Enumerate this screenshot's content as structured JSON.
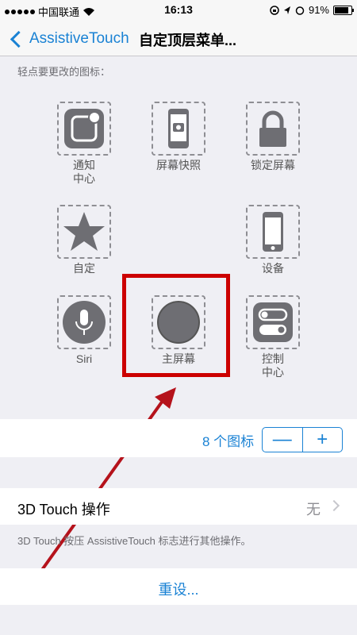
{
  "status_bar": {
    "carrier": "中国联通",
    "time": "16:13",
    "battery": "91%"
  },
  "nav": {
    "back_label": "AssistiveTouch",
    "title": "自定顶层菜单..."
  },
  "hint": "轻点要更改的图标：",
  "icons": [
    {
      "label": "通知\n中心",
      "icon": "notification-center-icon"
    },
    {
      "label": "屏幕快照",
      "icon": "screenshot-icon"
    },
    {
      "label": "锁定屏幕",
      "icon": "lock-icon"
    },
    {
      "label": "自定",
      "icon": "star-icon"
    },
    {
      "label": "设备",
      "icon": "device-icon"
    },
    {
      "label": "Siri",
      "icon": "siri-microphone-icon"
    },
    {
      "label": "主屏幕",
      "icon": "home-icon"
    },
    {
      "label": "控制\n中心",
      "icon": "control-center-icon"
    }
  ],
  "icon_count": {
    "label": "8 个图标",
    "minus": "—",
    "plus": "+"
  },
  "touch3d": {
    "label": "3D Touch 操作",
    "value": "无",
    "footnote": "3D Touch 按压 AssistiveTouch 标志进行其他操作。"
  },
  "reset": {
    "label": "重设..."
  },
  "colors": {
    "accent": "#1a82d4",
    "highlight": "#cc0000",
    "icon_gray": "#6e6e73"
  }
}
